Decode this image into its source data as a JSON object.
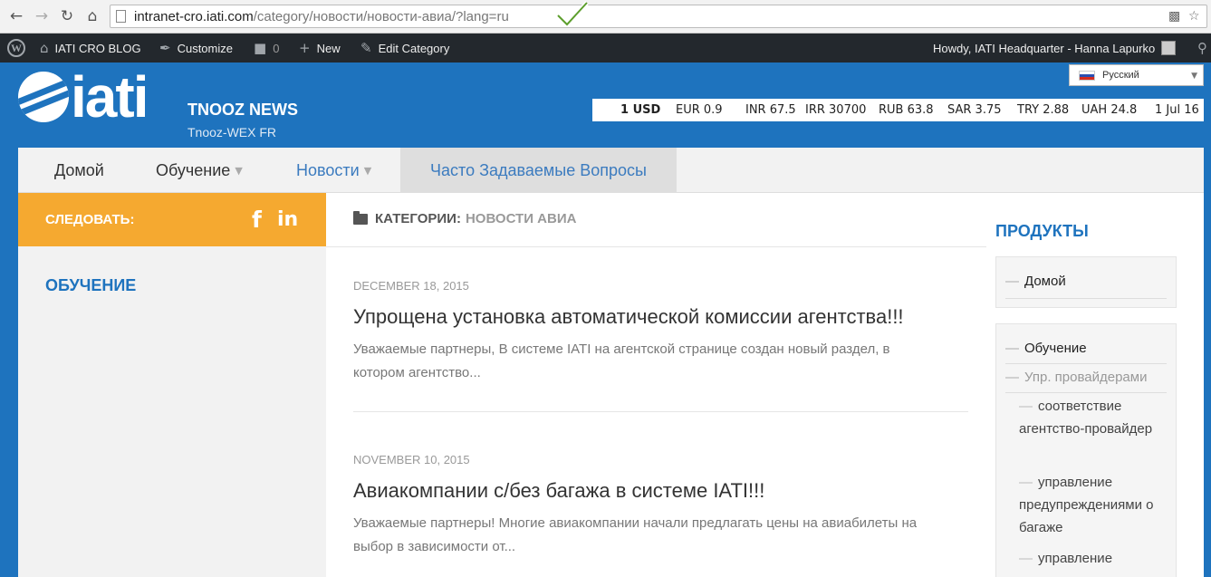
{
  "browser": {
    "url_host": "intranet-cro.iati.com",
    "url_path": "/category/новости/новости-авиа/?lang=ru"
  },
  "adminbar": {
    "blog": "IATI CRO BLOG",
    "customize": "Customize",
    "comments_count": "0",
    "new": "New",
    "edit_category": "Edit Category",
    "howdy": "Howdy, IATI Headquarter - Hanna Lapurko"
  },
  "header": {
    "brand": "iati",
    "site_title": "TNOOZ NEWS",
    "site_description": "Tnooz-WEX FR",
    "language": "Русский",
    "ticker": [
      "1 USD",
      "EUR 0.9",
      "INR 67.5",
      "IRR 30700",
      "RUB 63.8",
      "SAR 3.75",
      "TRY 2.88",
      "UAH 24.8",
      "1 Jul 16"
    ]
  },
  "menu": [
    {
      "label": "Домой"
    },
    {
      "label": "Обучение"
    },
    {
      "label": "Новости"
    },
    {
      "label": "Часто Задаваемые Вопросы"
    }
  ],
  "left": {
    "follow_label": "СЛЕДОВАТЬ:",
    "heading": "ОБУЧЕНИЕ"
  },
  "main": {
    "category_prefix": "КАТЕГОРИИ:",
    "category_name": "НОВОСТИ АВИА",
    "posts": [
      {
        "date": "DECEMBER 18, 2015",
        "title": "Упрощена установка автоматической комиссии агентства!!!",
        "excerpt": "Уважаемые партнеры, В системе IATI на агентской странице создан новый раздел, в котором агентство..."
      },
      {
        "date": "NOVEMBER 10, 2015",
        "title": "Авиакомпании с/без багажа в системе IATI!!!",
        "excerpt": "Уважаемые партнеры! Многие авиакомпании начали предлагать цены на авиабилеты на выбор в зависимости от..."
      }
    ]
  },
  "right": {
    "heading": "ПРОДУКТЫ",
    "widget1": [
      "Домой"
    ],
    "widget2": {
      "top": "Обучение",
      "sub": "Упр. провайдерами",
      "children": [
        "соответствие агентство-провайдер",
        "управление предупреждениями о багаже",
        "управление"
      ]
    }
  },
  "colors": {
    "brand_blue": "#1e73be",
    "follow_orange": "#f5a930",
    "adminbar": "#23282d"
  }
}
